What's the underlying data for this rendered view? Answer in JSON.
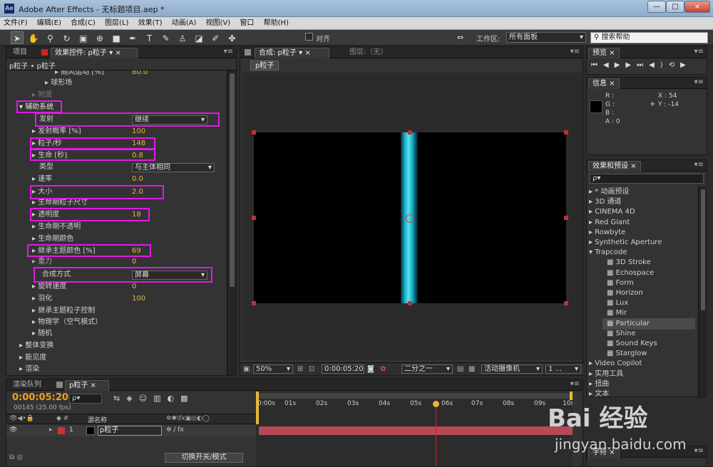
{
  "window": {
    "title": "Adobe After Effects - 无标题项目.aep *",
    "app_icon": "Ae",
    "min": "—",
    "max": "□",
    "close": "×"
  },
  "menu": [
    "文件(F)",
    "编辑(E)",
    "合成(C)",
    "图层(L)",
    "效果(T)",
    "动画(A)",
    "视图(V)",
    "窗口",
    "帮助(H)"
  ],
  "toolbar": {
    "align_label": "对齐",
    "workspace_label": "工作区:",
    "workspace_value": "所有面板",
    "search_placeholder": "搜索帮助"
  },
  "left_panel": {
    "tab_project": "项目",
    "tab_effects": "效果控件: p粒子",
    "breadcrumb": "p粒子 • p粒子",
    "rows": [
      {
        "label": "随风运动 [%]",
        "value": "80.0"
      },
      {
        "label": "球形场",
        "value": ""
      },
      {
        "label": "附属",
        "value": ""
      },
      {
        "label": "辅助系统",
        "value": ""
      },
      {
        "label": "发射",
        "value": "继续"
      },
      {
        "label": "发射概率 [%]",
        "value": "100"
      },
      {
        "label": "粒子/秒",
        "value": "148"
      },
      {
        "label": "生命 [秒]",
        "value": "0.8"
      },
      {
        "label": "类型",
        "value": "与主体相同"
      },
      {
        "label": "速率",
        "value": "0.0"
      },
      {
        "label": "大小",
        "value": "2.0"
      },
      {
        "label": "生命期粒子尺寸",
        "value": ""
      },
      {
        "label": "透明度",
        "value": "18"
      },
      {
        "label": "生命期不透明",
        "value": ""
      },
      {
        "label": "生命期颜色",
        "value": ""
      },
      {
        "label": "继承主题颜色 [%]",
        "value": "69"
      },
      {
        "label": "重力",
        "value": "0"
      },
      {
        "label": "合成方式",
        "value": "屏幕"
      },
      {
        "label": "旋转速度",
        "value": "0"
      },
      {
        "label": "羽化",
        "value": "100"
      },
      {
        "label": "继承主题粒子控制",
        "value": ""
      },
      {
        "label": "物理学（空气模式）",
        "value": ""
      },
      {
        "label": "随机",
        "value": ""
      },
      {
        "label": "整体变换",
        "value": ""
      },
      {
        "label": "能见度",
        "value": ""
      },
      {
        "label": "渲染",
        "value": ""
      }
    ]
  },
  "comp_panel": {
    "tab_comp": "合成: p粒子",
    "tab_layer": "图层:（无）",
    "comp_button": "p粒子",
    "zoom": "50%",
    "timecode": "0:00:05:20",
    "resolution": "二分之一",
    "camera": "活动摄像机",
    "views": "1 ..."
  },
  "preview_panel": {
    "tab": "预览"
  },
  "info_panel": {
    "tab": "信息",
    "r": "R :",
    "g": "G :",
    "b": "B :",
    "a": "A : 0",
    "x": "X : 54",
    "y": "Y : -14"
  },
  "effects_panel": {
    "tab": "效果和预设",
    "search_placeholder": "ρ▾",
    "items": [
      {
        "label": "* 动画预设",
        "type": "folder"
      },
      {
        "label": "3D 通道",
        "type": "folder"
      },
      {
        "label": "CINEMA 4D",
        "type": "folder"
      },
      {
        "label": "Red Giant",
        "type": "folder"
      },
      {
        "label": "Rowbyte",
        "type": "folder"
      },
      {
        "label": "Synthetic Aperture",
        "type": "folder"
      },
      {
        "label": "Trapcode",
        "type": "open"
      },
      {
        "label": "3D Stroke",
        "type": "fx"
      },
      {
        "label": "Echospace",
        "type": "fx"
      },
      {
        "label": "Form",
        "type": "fx"
      },
      {
        "label": "Horizon",
        "type": "fx"
      },
      {
        "label": "Lux",
        "type": "fx"
      },
      {
        "label": "Mir",
        "type": "fx"
      },
      {
        "label": "Particular",
        "type": "fx-sel"
      },
      {
        "label": "Shine",
        "type": "fx"
      },
      {
        "label": "Sound Keys",
        "type": "fx"
      },
      {
        "label": "Starglow",
        "type": "fx"
      },
      {
        "label": "Video Copilot",
        "type": "folder"
      },
      {
        "label": "实用工具",
        "type": "folder"
      },
      {
        "label": "扭曲",
        "type": "folder"
      },
      {
        "label": "文本",
        "type": "folder"
      }
    ]
  },
  "bottom_right": {
    "tab": "字符"
  },
  "timeline": {
    "tab_render": "渲染队列",
    "tab_comp": "p粒子",
    "timecode": "0:00:05:20",
    "frames": "00145 (25.00 fps)",
    "col_source": "源名称",
    "layer_index": "1",
    "layer_name": "p粒子",
    "toggle_label": "切换开关/模式",
    "ruler": [
      "0:00s",
      "01s",
      "02s",
      "03s",
      "04s",
      "05s",
      "06s",
      "07s",
      "08s",
      "09s",
      "10s"
    ]
  },
  "watermark": {
    "text": "Bai 经验",
    "url": "jingyan.baidu.com"
  },
  "colors": {
    "highlight": "#e11ae6",
    "accent_value": "#e8b347",
    "particle": "#36c9d8",
    "track": "#b64a56",
    "playhead": "#e02020"
  }
}
